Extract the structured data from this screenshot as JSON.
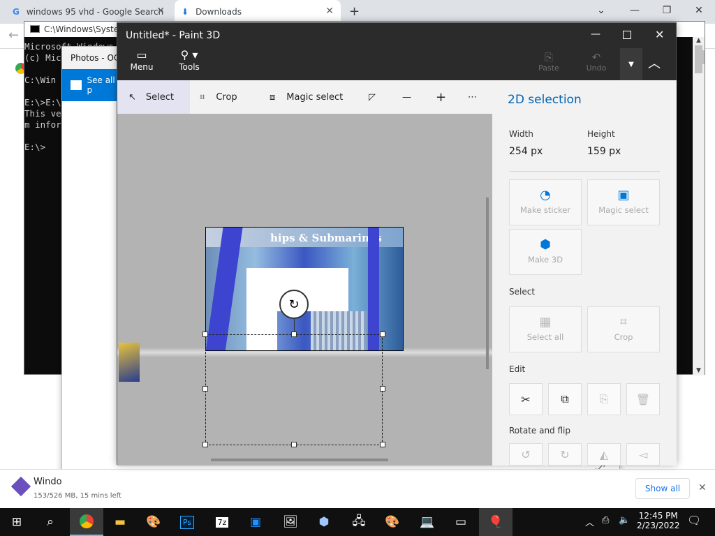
{
  "chrome": {
    "tabs": [
      {
        "label": "windows 95 vhd - Google Search",
        "icon": "google-icon"
      },
      {
        "label": "Downloads",
        "icon": "download-icon"
      }
    ],
    "new_tab": "+",
    "download": {
      "name": "Windo",
      "status": "153/526 MB, 15 mins left"
    },
    "show_all": "Show all"
  },
  "cmd": {
    "title": "C:\\Windows\\System",
    "lines": "Microsoft Windows\n(c) Mic\n\nC:\\Win\n\nE:\\>E:\\\nThis ve                                                                          ste\nm infor\n\nE:\\>"
  },
  "photos": {
    "title": "Photos - OCI",
    "see_all": "See all p"
  },
  "paint": {
    "title": "Untitled* - Paint 3D",
    "menu_label": "Menu",
    "tools_label": "Tools",
    "paste_label": "Paste",
    "undo_label": "Undo",
    "toolbar": {
      "select": "Select",
      "crop": "Crop",
      "magic_select": "Magic select",
      "more": "⋯"
    },
    "canvas_title": "hips & Submarines",
    "side": {
      "title": "2D selection",
      "width_label": "Width",
      "width_value": "254 px",
      "height_label": "Height",
      "height_value": "159 px",
      "make_sticker": "Make sticker",
      "magic_select": "Magic select",
      "make_3d": "Make 3D",
      "select_header": "Select",
      "select_all": "Select all",
      "crop": "Crop",
      "edit_header": "Edit",
      "rotate_header": "Rotate and flip"
    }
  },
  "taskbar": {
    "time": "12:45 PM",
    "date": "2/23/2022"
  },
  "colors": {
    "accent": "#0078d7",
    "dark_bar": "#2b2b2b"
  }
}
